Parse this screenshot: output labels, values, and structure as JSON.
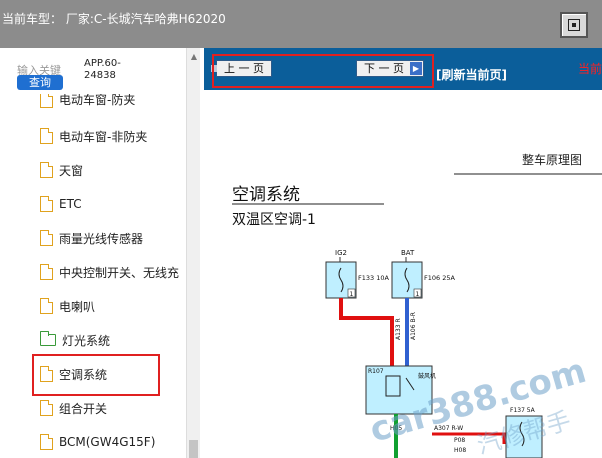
{
  "header": {
    "title": "当前车型：  厂家:C-长城汽车哈弗H62020"
  },
  "left_panel": {
    "search_label": "输入关键",
    "search_button": "查询",
    "app_code_line1": "APP.60-",
    "app_code_line2": "24838",
    "items": [
      {
        "label": "电动车窗-防夹",
        "icon": "file-icon"
      },
      {
        "label": "电动车窗-非防夹",
        "icon": "file-icon"
      },
      {
        "label": "天窗",
        "icon": "file-icon"
      },
      {
        "label": "ETC",
        "icon": "file-icon"
      },
      {
        "label": "雨量光线传感器",
        "icon": "file-icon"
      },
      {
        "label": "中央控制开关、无线充",
        "icon": "file-icon"
      },
      {
        "label": "电喇叭",
        "icon": "file-icon"
      },
      {
        "label": "灯光系统",
        "icon": "folder-icon"
      },
      {
        "label": "空调系统",
        "icon": "file-icon"
      },
      {
        "label": "组合开关",
        "icon": "file-icon"
      },
      {
        "label": "BCM(GW4G15F)",
        "icon": "file-icon"
      }
    ]
  },
  "toolbar": {
    "prev_label": "上 一 页",
    "next_label": "下 一 页",
    "refresh_label": "[刷新当前页]",
    "current_label": "当前"
  },
  "diagram": {
    "header": "整车原理图",
    "title": "空调系统",
    "subtitle": "双温区空调-1",
    "fuse1_top": "IG2",
    "fuse1_label": "F133 10A",
    "fuse2_top": "BAT",
    "fuse2_label": "F106 25A",
    "wire1": "A133 R",
    "wire2": "A106 B-R",
    "relay_id": "R107",
    "relay_text": "鼓风机",
    "wire3": "A307 R-W",
    "fuse3_label": "F137 5A",
    "p08": "P08",
    "h08": "H08",
    "h05": "H05",
    "pin1": "1",
    "pin2": "1",
    "watermark": "car388.com",
    "watermark2": "汽修帮手"
  },
  "colors": {
    "accent_blue": "#0b5e9a",
    "highlight_red": "#e02020",
    "wire_red": "#e01010",
    "wire_blue": "#3060d0",
    "wire_green": "#10a030",
    "component_cyan": "#bfefff"
  }
}
